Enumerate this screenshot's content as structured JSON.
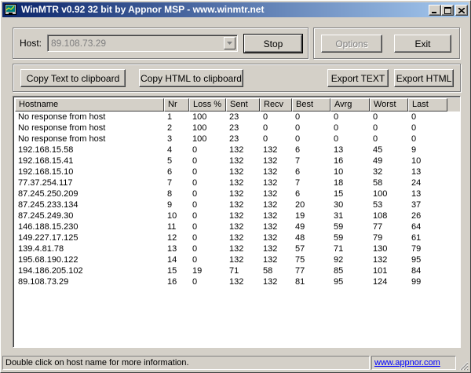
{
  "window": {
    "title": "WinMTR v0.92 32 bit by Appnor MSP - www.winmtr.net"
  },
  "host": {
    "label": "Host:",
    "value": "89.108.73.29"
  },
  "buttons": {
    "stop": "Stop",
    "options": "Options",
    "exit": "Exit",
    "copy_text": "Copy Text to clipboard",
    "copy_html": "Copy HTML to clipboard",
    "export_text": "Export TEXT",
    "export_html": "Export HTML"
  },
  "table": {
    "columns": [
      "Hostname",
      "Nr",
      "Loss %",
      "Sent",
      "Recv",
      "Best",
      "Avrg",
      "Worst",
      "Last"
    ],
    "rows": [
      [
        "No response from host",
        "1",
        "100",
        "23",
        "0",
        "0",
        "0",
        "0",
        "0"
      ],
      [
        "No response from host",
        "2",
        "100",
        "23",
        "0",
        "0",
        "0",
        "0",
        "0"
      ],
      [
        "No response from host",
        "3",
        "100",
        "23",
        "0",
        "0",
        "0",
        "0",
        "0"
      ],
      [
        "192.168.15.58",
        "4",
        "0",
        "132",
        "132",
        "6",
        "13",
        "45",
        "9"
      ],
      [
        "192.168.15.41",
        "5",
        "0",
        "132",
        "132",
        "7",
        "16",
        "49",
        "10"
      ],
      [
        "192.168.15.10",
        "6",
        "0",
        "132",
        "132",
        "6",
        "10",
        "32",
        "13"
      ],
      [
        "77.37.254.117",
        "7",
        "0",
        "132",
        "132",
        "7",
        "18",
        "58",
        "24"
      ],
      [
        "87.245.250.209",
        "8",
        "0",
        "132",
        "132",
        "6",
        "15",
        "100",
        "13"
      ],
      [
        "87.245.233.134",
        "9",
        "0",
        "132",
        "132",
        "20",
        "30",
        "53",
        "37"
      ],
      [
        "87.245.249.30",
        "10",
        "0",
        "132",
        "132",
        "19",
        "31",
        "108",
        "26"
      ],
      [
        "146.188.15.230",
        "11",
        "0",
        "132",
        "132",
        "49",
        "59",
        "77",
        "64"
      ],
      [
        "149.227.17.125",
        "12",
        "0",
        "132",
        "132",
        "48",
        "59",
        "79",
        "61"
      ],
      [
        "139.4.81.78",
        "13",
        "0",
        "132",
        "132",
        "57",
        "71",
        "130",
        "79"
      ],
      [
        "195.68.190.122",
        "14",
        "0",
        "132",
        "132",
        "75",
        "92",
        "132",
        "95"
      ],
      [
        "194.186.205.102",
        "15",
        "19",
        "71",
        "58",
        "77",
        "85",
        "101",
        "84"
      ],
      [
        "89.108.73.29",
        "16",
        "0",
        "132",
        "132",
        "81",
        "95",
        "124",
        "99"
      ]
    ]
  },
  "status": {
    "message": "Double click on host name for more information.",
    "link": "www.appnor.com"
  },
  "icons": {
    "app": "winmtr-app-icon",
    "minimize": "minimize-icon",
    "maximize": "maximize-icon",
    "close": "close-icon",
    "dropdown": "chevron-down-icon",
    "grip": "resize-grip-icon"
  }
}
